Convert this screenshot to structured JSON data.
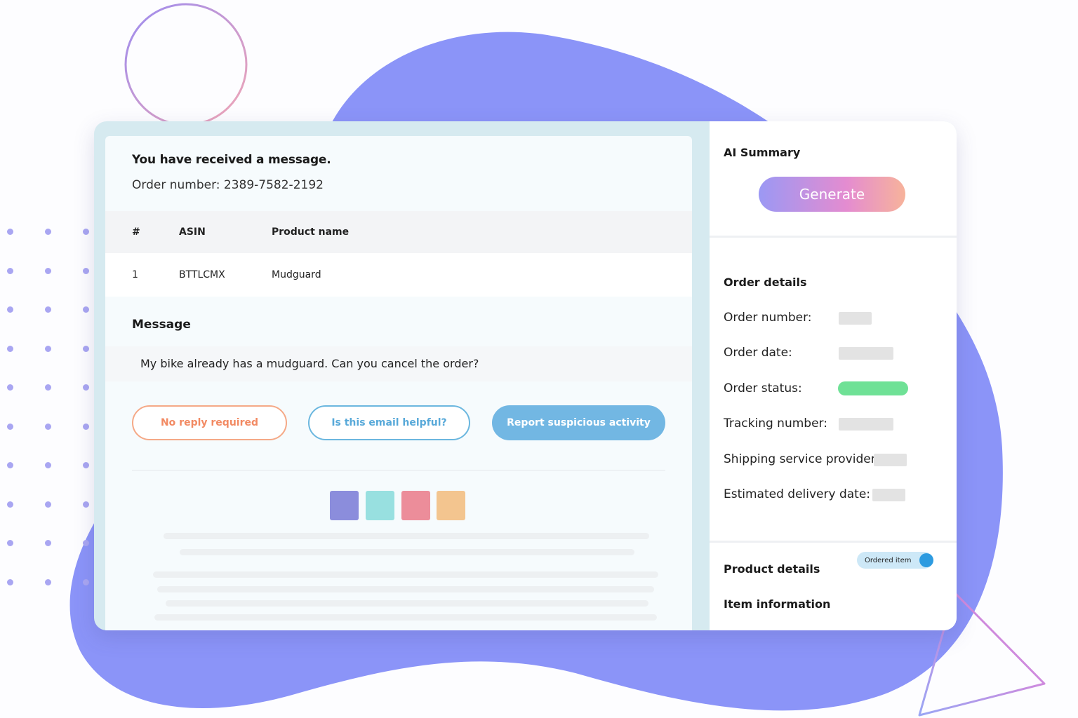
{
  "message": {
    "title": "You have received a message.",
    "order_line": "Order number: 2389-7582-2192"
  },
  "table": {
    "headers": [
      "#",
      "ASIN",
      "Product name"
    ],
    "rows": [
      [
        "1",
        "BTTLCMX",
        "Mudguard"
      ]
    ]
  },
  "message_section": {
    "label": "Message",
    "body": "My bike already has a mudguard. Can you cancel the order?"
  },
  "actions": {
    "no_reply": "No reply required",
    "helpful": "Is this email helpful?",
    "report": "Report suspicious activity"
  },
  "swatches": [
    "#8b8ddc",
    "#98e0e0",
    "#ec8d9a",
    "#f3c58f"
  ],
  "ai_summary": {
    "title": "AI Summary",
    "generate": "Generate"
  },
  "order_details": {
    "title": "Order details",
    "fields": [
      "Order number:",
      "Order date:",
      "Order status:",
      "Tracking number:",
      "Shipping service provider:",
      "Estimated delivery date:"
    ],
    "status_color": "#6fe196"
  },
  "product_details": {
    "title": "Product details",
    "toggle_label": "Ordered item",
    "item_information": "Item information"
  },
  "colors": {
    "blob": "#8b94f8",
    "accent_blue": "#72b7e3",
    "accent_orange": "#f28a63"
  }
}
